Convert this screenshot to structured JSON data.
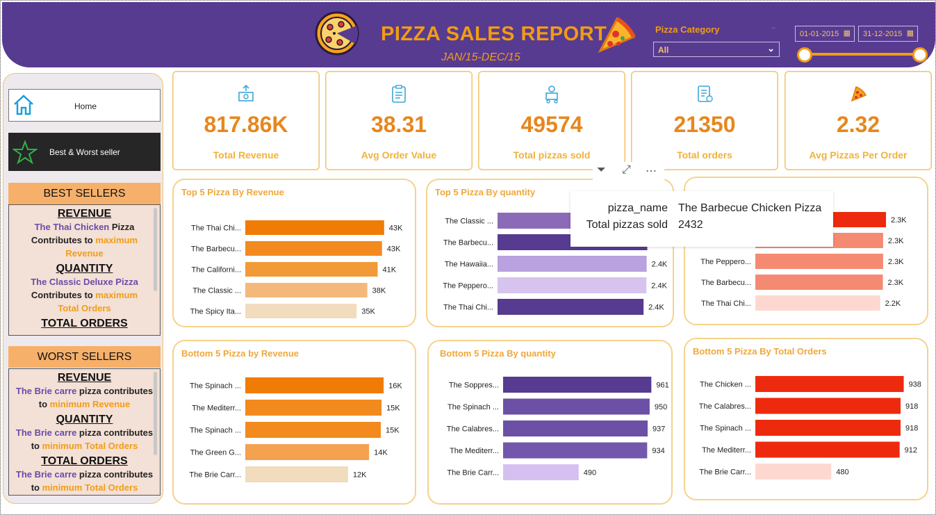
{
  "header": {
    "title": "PIZZA SALES REPORT",
    "subtitle": "JAN/15-DEC/15",
    "category_label": "Pizza Category",
    "category_value": "All",
    "date_start": "01-01-2015",
    "date_end": "31-12-2015",
    "colors": {
      "bg": "#573b91",
      "accent": "#f39c12"
    }
  },
  "sidebar": {
    "home_label": "Home",
    "best_worst_label": "Best & Worst seller",
    "best_heading": "BEST SELLERS",
    "worst_heading": "WORST SELLERS",
    "best": {
      "revenue_title": "REVENUE",
      "revenue_name": "The Thai Chicken",
      "revenue_tail": " Pizza",
      "revenue_contrib": "Contributes to ",
      "revenue_max": "maximum",
      "revenue_word": "Revenue",
      "quantity_title": "QUANTITY",
      "quantity_name": "The Classic Deluxe Pizza",
      "quantity_contrib": "Contributes to ",
      "quantity_max": "maximum",
      "quantity_word": "Total Orders",
      "orders_title": "TOTAL ORDERS"
    },
    "worst": {
      "revenue_title": "REVENUE",
      "revenue_name": "The Brie carre",
      "revenue_tail": " pizza contributes",
      "revenue_to": "to ",
      "revenue_min": "minimum Revenue",
      "quantity_title": "QUANTITY",
      "quantity_name": "The Brie carre",
      "quantity_tail": " pizza contributes",
      "quantity_to": "to ",
      "quantity_min": "minimum Total Orders",
      "orders_title": "TOTAL ORDERS",
      "orders_name": "The Brie carre",
      "orders_tail": " pizza contributes",
      "orders_to": "to ",
      "orders_min": "minimum Total Orders"
    }
  },
  "kpis": [
    {
      "value": "817.86K",
      "label": "Total Revenue",
      "icon": "money-icon"
    },
    {
      "value": "38.31",
      "label": "Avg Order Value",
      "icon": "clipboard-icon"
    },
    {
      "value": "49574",
      "label": "Total pizzas sold",
      "icon": "delivery-icon"
    },
    {
      "value": "21350",
      "label": "Total orders",
      "icon": "order-list-icon"
    },
    {
      "value": "2.32",
      "label": "Avg Pizzas Per Order",
      "icon": "pizza-slice-icon"
    }
  ],
  "tooltip": {
    "k1": "pizza_name",
    "v1": "The Barbecue Chicken Pizza",
    "k2": "Total pizzas sold",
    "v2": "2432"
  },
  "chart_data": [
    {
      "type": "bar",
      "title": "Top 5 Pizza By Revenue",
      "categories": [
        "The Thai Chi...",
        "The Barbecu...",
        "The Californi...",
        "The Classic ...",
        "The Spicy Ita..."
      ],
      "values": [
        43434,
        42768,
        41410,
        38180,
        34831
      ],
      "labels": [
        "43K",
        "43K",
        "41K",
        "38K",
        "35K"
      ],
      "colors": [
        "#f07c06",
        "#f28a1e",
        "#f39a38",
        "#f4b97a",
        "#f1dcbe"
      ],
      "xlim": [
        0,
        50000
      ]
    },
    {
      "type": "bar",
      "title": "Top 5 Pizza By quantity",
      "categories": [
        "The Classic ...",
        "The Barbecu...",
        "The Hawaiia...",
        "The Peppero...",
        "The Thai Chi..."
      ],
      "values": [
        2453,
        2432,
        2422,
        2418,
        2371
      ],
      "labels": [
        "2.5K",
        "2.4K",
        "2.4K",
        "2.4K",
        "2.4K"
      ],
      "colors": [
        "#8b6bb8",
        "#573b91",
        "#b9a2df",
        "#d6c4ef",
        "#573b91"
      ],
      "xlim": [
        0,
        2550
      ]
    },
    {
      "type": "bar",
      "title": "",
      "categories": [
        "",
        "",
        "The Peppero...",
        "The Barbecu...",
        "The Thai Chi..."
      ],
      "values": [
        2329,
        2278,
        2278,
        2273,
        2225
      ],
      "labels": [
        "2.3K",
        "2.3K",
        "2.3K",
        "2.3K",
        "2.2K"
      ],
      "colors": [
        "#ee2a0e",
        "#f58a72",
        "#f58a72",
        "#f58a72",
        "#fdd8d0"
      ],
      "xlim": [
        0,
        2750
      ]
    },
    {
      "type": "bar",
      "title": "Bottom 5 Pizza by Revenue",
      "categories": [
        "The Spinach ...",
        "The Mediterr...",
        "The Spinach ...",
        "The Green G...",
        "The Brie Carr..."
      ],
      "values": [
        15596,
        15360,
        15278,
        13955,
        11588
      ],
      "labels": [
        "16K",
        "15K",
        "15K",
        "14K",
        "12K"
      ],
      "colors": [
        "#f07c06",
        "#f28a1e",
        "#f28a1e",
        "#f4a150",
        "#f1dcbe"
      ],
      "xlim": [
        0,
        17000
      ]
    },
    {
      "type": "bar",
      "title": "Bottom 5 Pizza By quantity",
      "categories": [
        "The Soppres...",
        "The Spinach ...",
        "The Calabres...",
        "The Mediterr...",
        "The Brie Carr..."
      ],
      "values": [
        961,
        950,
        937,
        934,
        490
      ],
      "labels": [
        "961",
        "950",
        "937",
        "934",
        "490"
      ],
      "colors": [
        "#573b91",
        "#6c50a6",
        "#6c50a6",
        "#7357ad",
        "#d6c0f2"
      ],
      "xlim": [
        0,
        1000
      ]
    },
    {
      "type": "bar",
      "title": "Bottom 5 Pizza By Total Orders",
      "categories": [
        "The Chicken ...",
        "The Calabres...",
        "The Spinach ...",
        "The Mediterr...",
        "The Brie Carr..."
      ],
      "values": [
        938,
        918,
        918,
        912,
        480
      ],
      "labels": [
        "938",
        "918",
        "918",
        "912",
        "480"
      ],
      "colors": [
        "#ee2a0e",
        "#ee2a0e",
        "#ee2a0e",
        "#ee2a0e",
        "#fdd8d0"
      ],
      "xlim": [
        0,
        975
      ]
    }
  ]
}
